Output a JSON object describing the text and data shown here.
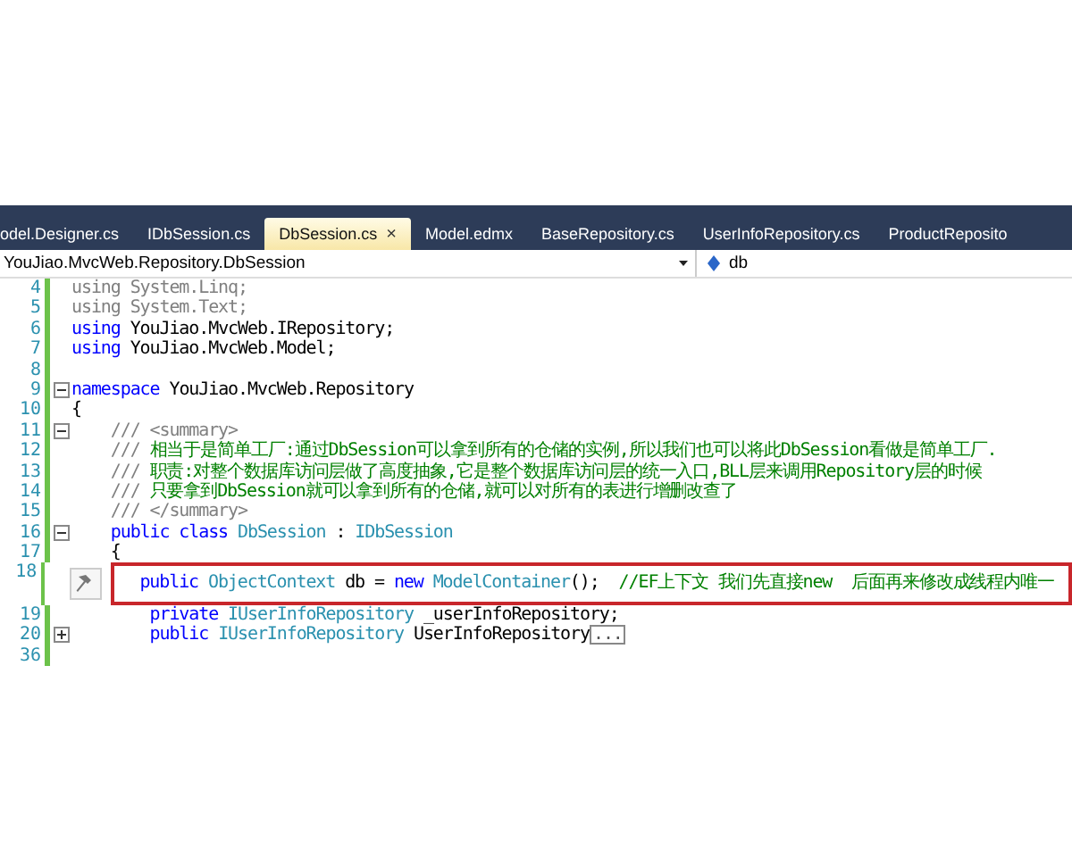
{
  "tabs": [
    {
      "label": "odel.Designer.cs",
      "selected": false
    },
    {
      "label": "IDbSession.cs",
      "selected": false
    },
    {
      "label": "DbSession.cs",
      "selected": true,
      "close": "×"
    },
    {
      "label": "Model.edmx",
      "selected": false
    },
    {
      "label": "BaseRepository.cs",
      "selected": false
    },
    {
      "label": "UserInfoRepository.cs",
      "selected": false
    },
    {
      "label": "ProductReposito",
      "selected": false
    }
  ],
  "navigation": {
    "type_scope": "YouJiao.MvcWeb.Repository.DbSession",
    "member": "db"
  },
  "lines": [
    {
      "number": "4",
      "tokens": [
        {
          "kind": "gray",
          "text": "using System.Linq;"
        }
      ]
    },
    {
      "number": "5",
      "tokens": [
        {
          "kind": "gray",
          "text": "using System.Text;"
        }
      ]
    },
    {
      "number": "6",
      "tokens": [
        {
          "kind": "keyword",
          "text": "using"
        },
        {
          "kind": "plain",
          "text": " YouJiao.MvcWeb.IRepository;"
        }
      ]
    },
    {
      "number": "7",
      "tokens": [
        {
          "kind": "keyword",
          "text": "using"
        },
        {
          "kind": "plain",
          "text": " YouJiao.MvcWeb.Model;"
        }
      ]
    },
    {
      "number": "8"
    },
    {
      "number": "9",
      "toggle": {
        "expanded": true
      },
      "tokens": [
        {
          "kind": "keyword",
          "text": "namespace"
        },
        {
          "kind": "plain",
          "text": " YouJiao.MvcWeb.Repository"
        }
      ]
    },
    {
      "number": "10",
      "tokens": [
        {
          "kind": "plain",
          "text": "{"
        }
      ]
    },
    {
      "number": "11",
      "toggle": {
        "expanded": true
      },
      "tokens": [
        {
          "kind": "gray",
          "text": "    /// <summary>"
        }
      ]
    },
    {
      "number": "12",
      "tokens": [
        {
          "kind": "gray",
          "text": "    ///"
        },
        {
          "kind": "comment",
          "text": " 相当于是简单工厂:通过DbSession可以拿到所有的仓储的实例,所以我们也可以将此DbSession看做是简单工厂."
        }
      ]
    },
    {
      "number": "13",
      "tokens": [
        {
          "kind": "gray",
          "text": "    ///"
        },
        {
          "kind": "comment",
          "text": " 职责:对整个数据库访问层做了高度抽象,它是整个数据库访问层的统一入口,BLL层来调用Repository层的时候"
        }
      ]
    },
    {
      "number": "14",
      "tokens": [
        {
          "kind": "gray",
          "text": "    ///"
        },
        {
          "kind": "comment",
          "text": " 只要拿到DbSession就可以拿到所有的仓储,就可以对所有的表进行增删改查了"
        }
      ]
    },
    {
      "number": "15",
      "tokens": [
        {
          "kind": "gray",
          "text": "    /// </summary>"
        }
      ]
    },
    {
      "number": "16",
      "toggle": {
        "expanded": true
      },
      "tokens": [
        {
          "kind": "keyword",
          "text": "    public class"
        },
        {
          "kind": "type",
          "text": " DbSession"
        },
        {
          "kind": "plain",
          "text": " : "
        },
        {
          "kind": "type",
          "text": "IDbSession"
        }
      ]
    },
    {
      "number": "17",
      "tokens": [
        {
          "kind": "plain",
          "text": "    {"
        }
      ]
    },
    {
      "number": "18",
      "highlighted": true,
      "smart_tag": true,
      "tokens": [
        {
          "kind": "keyword",
          "text": "public"
        },
        {
          "kind": "type",
          "text": " ObjectContext"
        },
        {
          "kind": "plain",
          "text": " db = "
        },
        {
          "kind": "keyword",
          "text": "new"
        },
        {
          "kind": "type",
          "text": " ModelContainer"
        },
        {
          "kind": "plain",
          "text": "();  "
        },
        {
          "kind": "comment",
          "text": "//EF上下文 我们先直接new  后面再来修改成线程内唯一"
        }
      ]
    },
    {
      "number": "19",
      "tokens": [
        {
          "kind": "keyword",
          "text": "        private"
        },
        {
          "kind": "type",
          "text": " IUserInfoRepository"
        },
        {
          "kind": "plain",
          "text": " _userInfoRepository;"
        }
      ]
    },
    {
      "number": "20",
      "toggle": {
        "expanded": false
      },
      "collapsed_text": "...",
      "tokens": [
        {
          "kind": "keyword",
          "text": "        public"
        },
        {
          "kind": "type",
          "text": " IUserInfoRepository"
        },
        {
          "kind": "plain",
          "text": " UserInfoRepository"
        }
      ]
    },
    {
      "number": "36"
    }
  ]
}
